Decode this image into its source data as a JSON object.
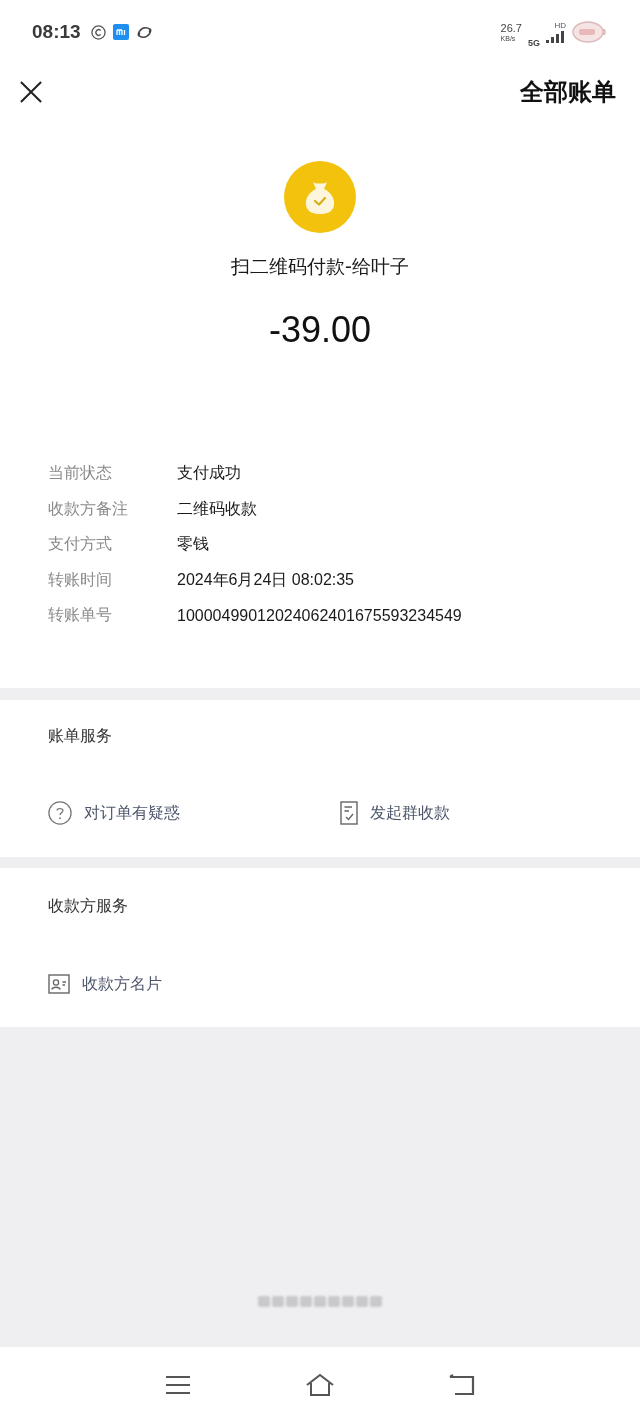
{
  "status_bar": {
    "time": "08:13",
    "net_speed": "26.7",
    "net_speed_unit": "KB/s",
    "network": "5G",
    "signal_label": "HD"
  },
  "header": {
    "link": "全部账单"
  },
  "transaction": {
    "title": "扫二维码付款-给叶子",
    "amount": "-39.00"
  },
  "details": [
    {
      "label": "当前状态",
      "value": "支付成功"
    },
    {
      "label": "收款方备注",
      "value": "二维码收款"
    },
    {
      "label": "支付方式",
      "value": "零钱"
    },
    {
      "label": "转账时间",
      "value": "2024年6月24日 08:02:35"
    },
    {
      "label": "转账单号",
      "value": "10000499012024062401675593234549"
    }
  ],
  "sections": [
    {
      "title": "账单服务",
      "actions": [
        {
          "label": "对订单有疑惑",
          "kind": "question"
        },
        {
          "label": "发起群收款",
          "kind": "document"
        }
      ]
    },
    {
      "title": "收款方服务",
      "actions": [
        {
          "label": "收款方名片",
          "kind": "contact"
        }
      ]
    }
  ]
}
